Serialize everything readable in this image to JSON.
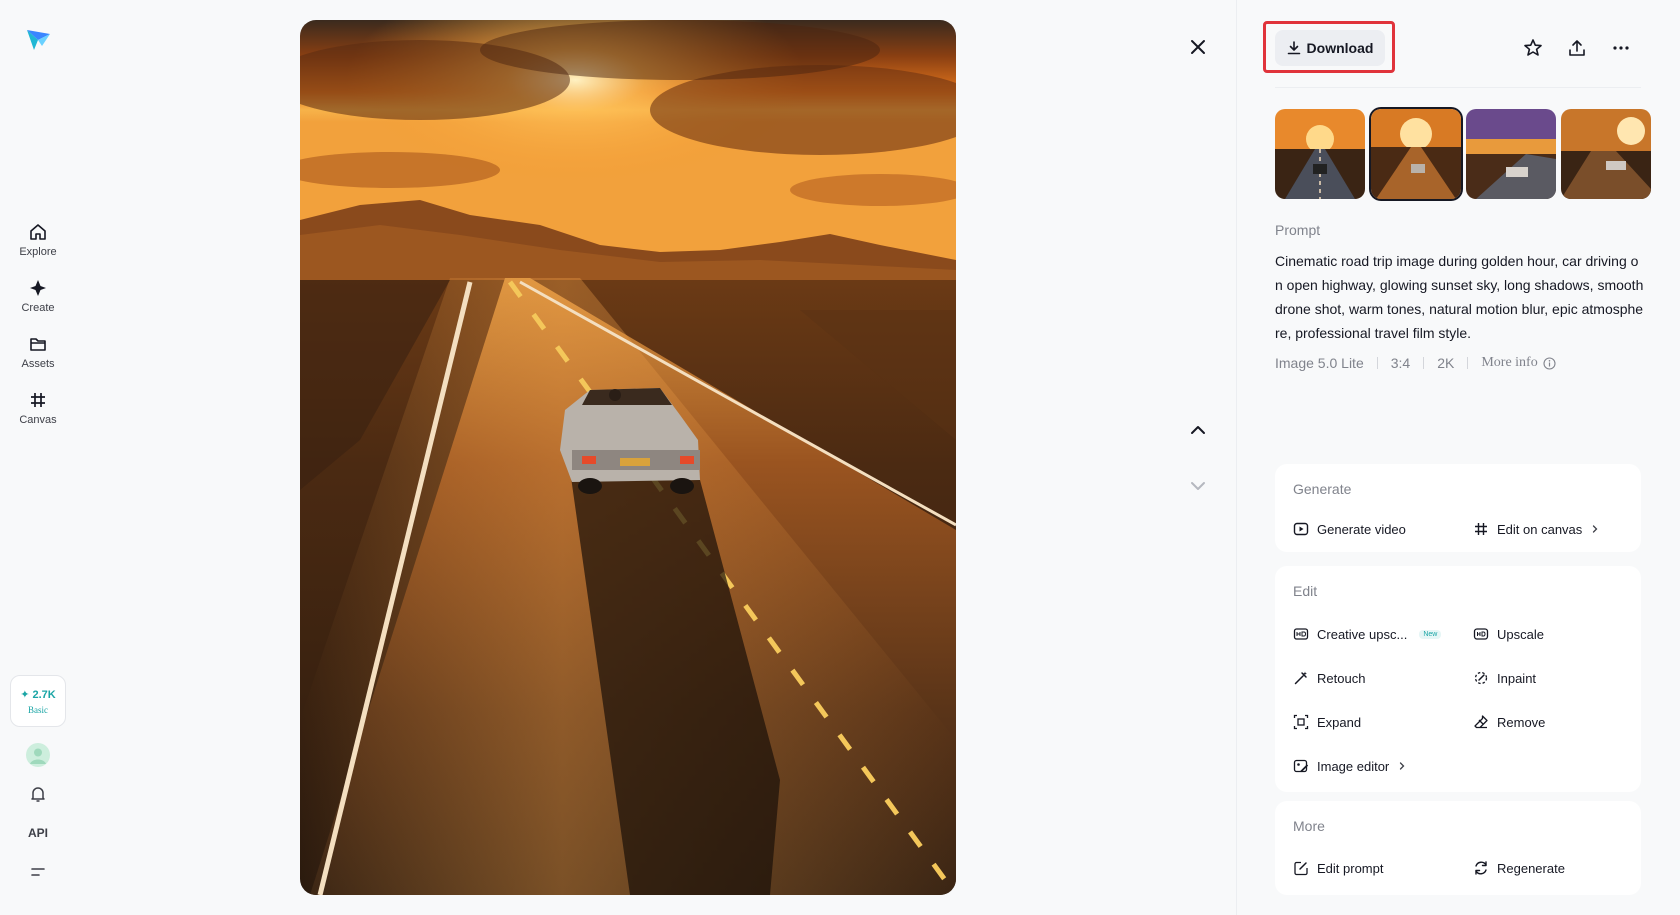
{
  "nav": {
    "items": [
      {
        "label": "Explore",
        "icon": "home-icon"
      },
      {
        "label": "Create",
        "icon": "sparkle-icon"
      },
      {
        "label": "Assets",
        "icon": "folder-icon"
      },
      {
        "label": "Canvas",
        "icon": "canvas-icon"
      }
    ],
    "credits": {
      "amount": "✦ 2.7K",
      "plan": "Basic"
    },
    "api_label": "API"
  },
  "toolbar": {
    "download_label": "Download"
  },
  "prompt": {
    "title": "Prompt",
    "text": "Cinematic road trip image during golden hour, car driving on open highway, glowing sunset sky, long shadows, smooth drone shot, warm tones, natural motion blur, epic atmosphere, professional travel film style.",
    "model": "Image 5.0 Lite",
    "ratio": "3:4",
    "resolution": "2K",
    "more_info": "More info"
  },
  "generate": {
    "title": "Generate",
    "video": "Generate video",
    "canvas": "Edit on canvas"
  },
  "edit": {
    "title": "Edit",
    "creative_upscale": "Creative upsc...",
    "new_badge": "New",
    "upscale": "Upscale",
    "retouch": "Retouch",
    "inpaint": "Inpaint",
    "expand": "Expand",
    "remove": "Remove",
    "image_editor": "Image editor"
  },
  "more": {
    "title": "More",
    "edit_prompt": "Edit prompt",
    "regenerate": "Regenerate"
  },
  "colors": {
    "accent": "#1aa5a5",
    "highlight": "#e0333b"
  }
}
